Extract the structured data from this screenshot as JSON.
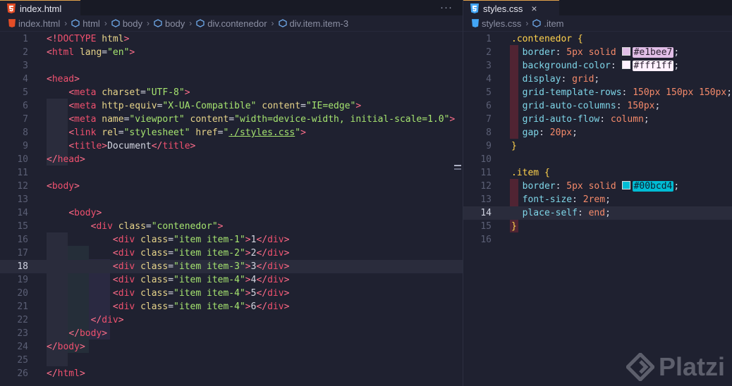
{
  "left": {
    "tab": "index.html",
    "more": "···",
    "breadcrumb": [
      "index.html",
      "html",
      "body",
      "body",
      "div.contenedor",
      "div.item.item-3"
    ],
    "lines": [
      {
        "n": "1",
        "tokens": [
          [
            "p",
            "<!"
          ],
          [
            "t",
            "DOCTYPE"
          ],
          [
            "x",
            " "
          ],
          [
            "a",
            "html"
          ],
          [
            "p",
            ">"
          ]
        ]
      },
      {
        "n": "2",
        "tokens": [
          [
            "p",
            "<"
          ],
          [
            "t",
            "html"
          ],
          [
            "x",
            " "
          ],
          [
            "a",
            "lang"
          ],
          [
            "x",
            "="
          ],
          [
            "s",
            "\"en\""
          ],
          [
            "p",
            ">"
          ]
        ]
      },
      {
        "n": "3",
        "tokens": []
      },
      {
        "n": "4",
        "tokens": [
          [
            "p",
            "<"
          ],
          [
            "t",
            "head"
          ],
          [
            "p",
            ">"
          ]
        ]
      },
      {
        "n": "5",
        "tokens": [
          [
            "x",
            "    "
          ],
          [
            "p",
            "<"
          ],
          [
            "t",
            "meta"
          ],
          [
            "x",
            " "
          ],
          [
            "a",
            "charset"
          ],
          [
            "x",
            "="
          ],
          [
            "s",
            "\"UTF-8\""
          ],
          [
            "p",
            ">"
          ]
        ]
      },
      {
        "n": "6",
        "tokens": [
          [
            "x",
            "    "
          ],
          [
            "p",
            "<"
          ],
          [
            "t",
            "meta"
          ],
          [
            "x",
            " "
          ],
          [
            "a",
            "http-equiv"
          ],
          [
            "x",
            "="
          ],
          [
            "s",
            "\"X-UA-Compatible\""
          ],
          [
            "x",
            " "
          ],
          [
            "a",
            "content"
          ],
          [
            "x",
            "="
          ],
          [
            "s",
            "\"IE=edge\""
          ],
          [
            "p",
            ">"
          ]
        ]
      },
      {
        "n": "7",
        "tokens": [
          [
            "x",
            "    "
          ],
          [
            "p",
            "<"
          ],
          [
            "t",
            "meta"
          ],
          [
            "x",
            " "
          ],
          [
            "a",
            "name"
          ],
          [
            "x",
            "="
          ],
          [
            "s",
            "\"viewport\""
          ],
          [
            "x",
            " "
          ],
          [
            "a",
            "content"
          ],
          [
            "x",
            "="
          ],
          [
            "s",
            "\"width=device-width, initial-scale=1.0\""
          ],
          [
            "p",
            ">"
          ]
        ]
      },
      {
        "n": "8",
        "tokens": [
          [
            "x",
            "    "
          ],
          [
            "p",
            "<"
          ],
          [
            "t",
            "link"
          ],
          [
            "x",
            " "
          ],
          [
            "a",
            "rel"
          ],
          [
            "x",
            "="
          ],
          [
            "s",
            "\"stylesheet\""
          ],
          [
            "x",
            " "
          ],
          [
            "a",
            "href"
          ],
          [
            "x",
            "="
          ],
          [
            "s",
            "\""
          ],
          [
            "u",
            "./styles.css"
          ],
          [
            "s",
            "\""
          ],
          [
            "p",
            ">"
          ]
        ]
      },
      {
        "n": "9",
        "tokens": [
          [
            "x",
            "    "
          ],
          [
            "p",
            "<"
          ],
          [
            "t",
            "title"
          ],
          [
            "p",
            ">"
          ],
          [
            "x",
            "Document"
          ],
          [
            "p",
            "</"
          ],
          [
            "t",
            "title"
          ],
          [
            "p",
            ">"
          ]
        ]
      },
      {
        "n": "10",
        "tokens": [
          [
            "p",
            "</"
          ],
          [
            "t",
            "head"
          ],
          [
            "p",
            ">"
          ]
        ]
      },
      {
        "n": "11",
        "tokens": []
      },
      {
        "n": "12",
        "tokens": [
          [
            "p",
            "<"
          ],
          [
            "t",
            "body"
          ],
          [
            "p",
            ">"
          ]
        ]
      },
      {
        "n": "13",
        "tokens": []
      },
      {
        "n": "14",
        "tokens": [
          [
            "x",
            "    "
          ],
          [
            "p",
            "<"
          ],
          [
            "t",
            "body"
          ],
          [
            "p",
            ">"
          ]
        ]
      },
      {
        "n": "15",
        "tokens": [
          [
            "x",
            "        "
          ],
          [
            "p",
            "<"
          ],
          [
            "t",
            "div"
          ],
          [
            "x",
            " "
          ],
          [
            "a",
            "class"
          ],
          [
            "x",
            "="
          ],
          [
            "s",
            "\"contenedor\""
          ],
          [
            "p",
            ">"
          ]
        ]
      },
      {
        "n": "16",
        "tokens": [
          [
            "x",
            "            "
          ],
          [
            "p",
            "<"
          ],
          [
            "t",
            "div"
          ],
          [
            "x",
            " "
          ],
          [
            "a",
            "class"
          ],
          [
            "x",
            "="
          ],
          [
            "s",
            "\"item item-1\""
          ],
          [
            "p",
            ">"
          ],
          [
            "x",
            "1"
          ],
          [
            "p",
            "</"
          ],
          [
            "t",
            "div"
          ],
          [
            "p",
            ">"
          ]
        ]
      },
      {
        "n": "17",
        "tokens": [
          [
            "x",
            "            "
          ],
          [
            "p",
            "<"
          ],
          [
            "t",
            "div"
          ],
          [
            "x",
            " "
          ],
          [
            "a",
            "class"
          ],
          [
            "x",
            "="
          ],
          [
            "s",
            "\"item item-2\""
          ],
          [
            "p",
            ">"
          ],
          [
            "x",
            "2"
          ],
          [
            "p",
            "</"
          ],
          [
            "t",
            "div"
          ],
          [
            "p",
            ">"
          ]
        ]
      },
      {
        "n": "18",
        "tokens": [
          [
            "x",
            "            "
          ],
          [
            "p",
            "<"
          ],
          [
            "t",
            "div"
          ],
          [
            "x",
            " "
          ],
          [
            "a",
            "class"
          ],
          [
            "x",
            "="
          ],
          [
            "s",
            "\"item item-3\""
          ],
          [
            "p",
            ">"
          ],
          [
            "x",
            "3"
          ],
          [
            "p",
            "</"
          ],
          [
            "t",
            "div"
          ],
          [
            "p",
            ">"
          ]
        ]
      },
      {
        "n": "19",
        "tokens": [
          [
            "x",
            "            "
          ],
          [
            "p",
            "<"
          ],
          [
            "t",
            "div"
          ],
          [
            "x",
            " "
          ],
          [
            "a",
            "class"
          ],
          [
            "x",
            "="
          ],
          [
            "s",
            "\"item item-4\""
          ],
          [
            "p",
            ">"
          ],
          [
            "x",
            "4"
          ],
          [
            "p",
            "</"
          ],
          [
            "t",
            "div"
          ],
          [
            "p",
            ">"
          ]
        ]
      },
      {
        "n": "20",
        "tokens": [
          [
            "x",
            "            "
          ],
          [
            "p",
            "<"
          ],
          [
            "t",
            "div"
          ],
          [
            "x",
            " "
          ],
          [
            "a",
            "class"
          ],
          [
            "x",
            "="
          ],
          [
            "s",
            "\"item item-4\""
          ],
          [
            "p",
            ">"
          ],
          [
            "x",
            "5"
          ],
          [
            "p",
            "</"
          ],
          [
            "t",
            "div"
          ],
          [
            "p",
            ">"
          ]
        ]
      },
      {
        "n": "21",
        "tokens": [
          [
            "x",
            "            "
          ],
          [
            "p",
            "<"
          ],
          [
            "t",
            "div"
          ],
          [
            "x",
            " "
          ],
          [
            "a",
            "class"
          ],
          [
            "x",
            "="
          ],
          [
            "s",
            "\"item item-4\""
          ],
          [
            "p",
            ">"
          ],
          [
            "x",
            "6"
          ],
          [
            "p",
            "</"
          ],
          [
            "t",
            "div"
          ],
          [
            "p",
            ">"
          ]
        ]
      },
      {
        "n": "22",
        "tokens": [
          [
            "x",
            "        "
          ],
          [
            "p",
            "</"
          ],
          [
            "t",
            "div"
          ],
          [
            "p",
            ">"
          ]
        ]
      },
      {
        "n": "23",
        "tokens": [
          [
            "x",
            "    "
          ],
          [
            "p",
            "</"
          ],
          [
            "t",
            "body"
          ],
          [
            "p",
            ">"
          ]
        ]
      },
      {
        "n": "24",
        "tokens": [
          [
            "p",
            "</"
          ],
          [
            "t",
            "body"
          ],
          [
            "p",
            ">"
          ]
        ]
      },
      {
        "n": "25",
        "tokens": []
      },
      {
        "n": "26",
        "tokens": [
          [
            "p",
            "</"
          ],
          [
            "t",
            "html"
          ],
          [
            "p",
            ">"
          ]
        ]
      }
    ],
    "active_line": "18"
  },
  "right": {
    "tab": "styles.css",
    "tab_close": "×",
    "breadcrumb": [
      "styles.css",
      ".item"
    ],
    "lines": [
      {
        "n": "1",
        "tokens": [
          [
            "k",
            ".contenedor"
          ],
          [
            "x",
            " "
          ],
          [
            "br",
            "{"
          ]
        ]
      },
      {
        "n": "2",
        "tokens": [
          [
            "x",
            "  "
          ],
          [
            "pr",
            "border"
          ],
          [
            "x",
            ": "
          ],
          [
            "v",
            "5px"
          ],
          [
            "x",
            " "
          ],
          [
            "v",
            "solid"
          ],
          [
            "x",
            " "
          ],
          [
            "sw",
            "#e1bee7"
          ],
          [
            "hex",
            "#e1bee7"
          ],
          [
            "x",
            ";"
          ]
        ]
      },
      {
        "n": "3",
        "tokens": [
          [
            "x",
            "  "
          ],
          [
            "pr",
            "background-color"
          ],
          [
            "x",
            ": "
          ],
          [
            "sw",
            "#fff1ff"
          ],
          [
            "hex",
            "#fff1ff"
          ],
          [
            "x",
            ";"
          ]
        ]
      },
      {
        "n": "4",
        "tokens": [
          [
            "x",
            "  "
          ],
          [
            "pr",
            "display"
          ],
          [
            "x",
            ": "
          ],
          [
            "v",
            "grid"
          ],
          [
            "x",
            ";"
          ]
        ]
      },
      {
        "n": "5",
        "tokens": [
          [
            "x",
            "  "
          ],
          [
            "pr",
            "grid-template-rows"
          ],
          [
            "x",
            ": "
          ],
          [
            "v",
            "150px 150px 150px"
          ],
          [
            "x",
            ";"
          ]
        ]
      },
      {
        "n": "6",
        "tokens": [
          [
            "x",
            "  "
          ],
          [
            "pr",
            "grid-auto-columns"
          ],
          [
            "x",
            ": "
          ],
          [
            "v",
            "150px"
          ],
          [
            "x",
            ";"
          ]
        ]
      },
      {
        "n": "7",
        "tokens": [
          [
            "x",
            "  "
          ],
          [
            "pr",
            "grid-auto-flow"
          ],
          [
            "x",
            ": "
          ],
          [
            "v",
            "column"
          ],
          [
            "x",
            ";"
          ]
        ]
      },
      {
        "n": "8",
        "tokens": [
          [
            "x",
            "  "
          ],
          [
            "pr",
            "gap"
          ],
          [
            "x",
            ": "
          ],
          [
            "v",
            "20px"
          ],
          [
            "x",
            ";"
          ]
        ]
      },
      {
        "n": "9",
        "tokens": [
          [
            "br",
            "}"
          ]
        ]
      },
      {
        "n": "10",
        "tokens": []
      },
      {
        "n": "11",
        "tokens": [
          [
            "k",
            ".item"
          ],
          [
            "x",
            " "
          ],
          [
            "br",
            "{"
          ]
        ]
      },
      {
        "n": "12",
        "tokens": [
          [
            "x",
            "  "
          ],
          [
            "pr",
            "border"
          ],
          [
            "x",
            ": "
          ],
          [
            "v",
            "5px"
          ],
          [
            "x",
            " "
          ],
          [
            "v",
            "solid"
          ],
          [
            "x",
            " "
          ],
          [
            "sw",
            "#00bcd4"
          ],
          [
            "hex",
            "#00bcd4"
          ],
          [
            "x",
            ";"
          ]
        ]
      },
      {
        "n": "13",
        "tokens": [
          [
            "x",
            "  "
          ],
          [
            "pr",
            "font-size"
          ],
          [
            "x",
            ": "
          ],
          [
            "v",
            "2rem"
          ],
          [
            "x",
            ";"
          ]
        ]
      },
      {
        "n": "14",
        "tokens": [
          [
            "x",
            "  "
          ],
          [
            "pr",
            "place-self"
          ],
          [
            "x",
            ": "
          ],
          [
            "v",
            "end"
          ],
          [
            "x",
            ";"
          ]
        ]
      },
      {
        "n": "15",
        "tokens": [
          [
            "br",
            "}"
          ]
        ]
      },
      {
        "n": "16",
        "tokens": []
      }
    ],
    "active_line": "14"
  },
  "logo_text": "Platzi",
  "colors": {
    "tab_accent": "#e0a04a",
    "html_icon": "#e44d26",
    "css_icon": "#42a5f5"
  }
}
